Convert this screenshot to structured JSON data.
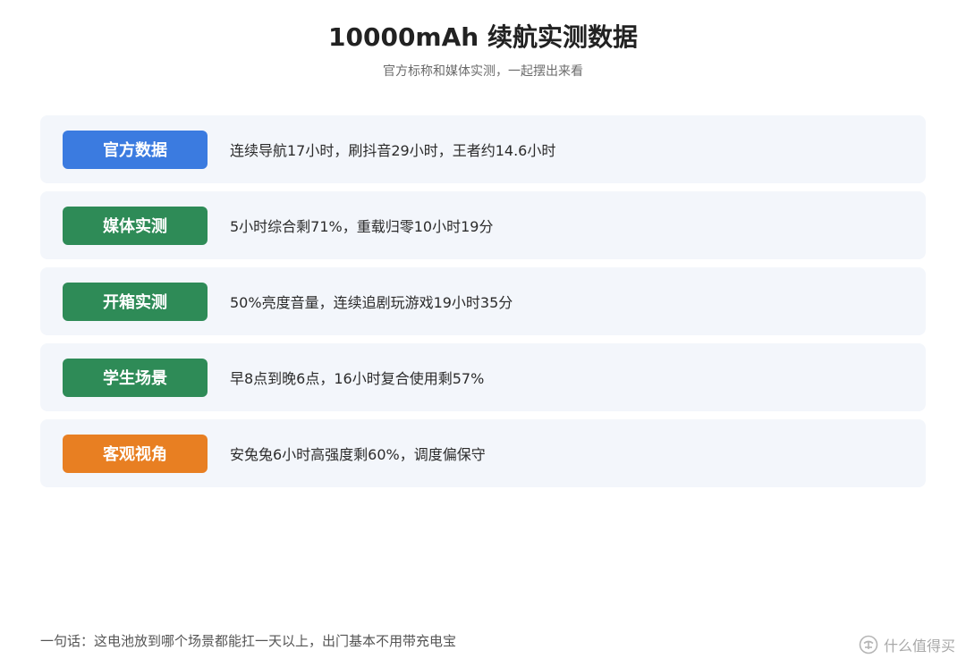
{
  "header": {
    "title": "10000mAh 续航实测数据",
    "subtitle": "官方标称和媒体实测，一起摆出来看"
  },
  "rows": [
    {
      "label": "官方数据",
      "text": "连续导航17小时，刷抖音29小时，王者约14.6小时",
      "color": "#3b7be0"
    },
    {
      "label": "媒体实测",
      "text": "5小时综合剩71%，重载归零10小时19分",
      "color": "#2e8b57"
    },
    {
      "label": "开箱实测",
      "text": "50%亮度音量，连续追剧玩游戏19小时35分",
      "color": "#2e8b57"
    },
    {
      "label": "学生场景",
      "text": "早8点到晚6点，16小时复合使用剩57%",
      "color": "#2e8b57"
    },
    {
      "label": "客观视角",
      "text": "安兔兔6小时高强度剩60%，调度偏保守",
      "color": "#e87f22"
    }
  ],
  "footer": {
    "text": "一句话：这电池放到哪个场景都能扛一天以上，出门基本不用带充电宝"
  },
  "watermark": {
    "icon": "smzdm-logo-icon",
    "text": "什么值得买"
  }
}
